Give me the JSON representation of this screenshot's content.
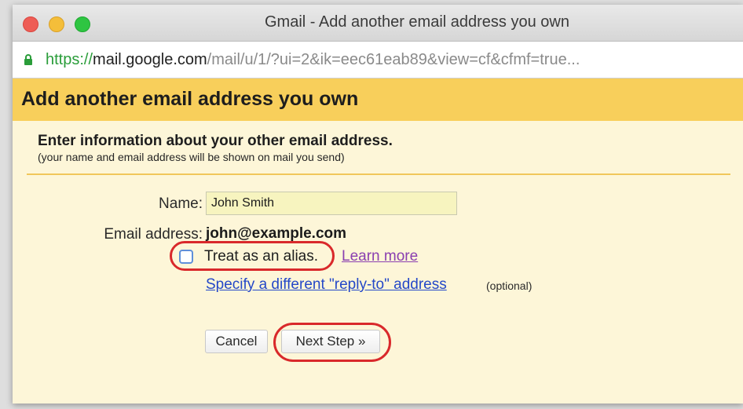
{
  "window": {
    "title": "Gmail - Add another email address you own"
  },
  "address_bar": {
    "scheme": "https://",
    "host": "mail.google.com",
    "path": "/mail/u/1/?ui=2&ik=eec61eab89&view=cf&cfmf=true..."
  },
  "dialog": {
    "title": "Add another email address you own",
    "intro_heading": "Enter information about your other email address.",
    "intro_sub": "(your name and email address will be shown on mail you send)",
    "name_label": "Name:",
    "name_value": "John Smith",
    "email_label": "Email address:",
    "email_value": "john@example.com",
    "alias_label": "Treat as an alias.",
    "alias_checked": false,
    "learn_more": "Learn more",
    "reply_to_link": "Specify a different \"reply-to\" address",
    "reply_to_optional": "(optional)",
    "cancel_label": "Cancel",
    "next_label": "Next Step »"
  },
  "colors": {
    "header_bg": "#f8cf5b",
    "body_bg": "#fdf6d8",
    "highlight": "#d9292b",
    "link": "#2448c8",
    "visited_link": "#8a3fb0",
    "secure": "#2a9d3a"
  },
  "icons": {
    "lock": "lock-icon"
  }
}
